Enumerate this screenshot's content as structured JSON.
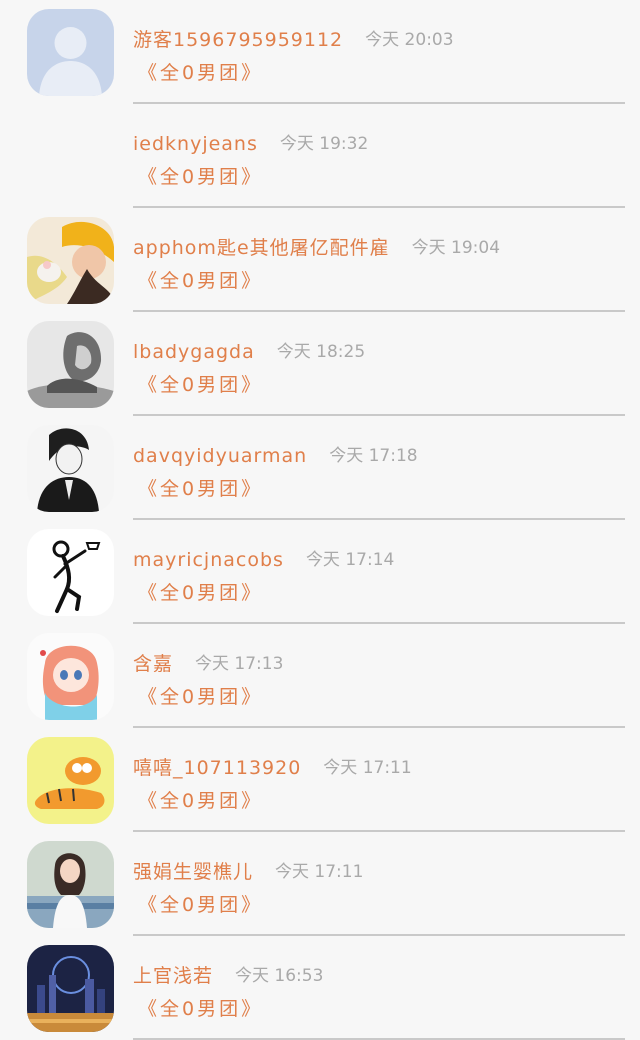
{
  "threads": [
    {
      "name": "游客1596795959112",
      "time": "今天 20:03",
      "subtitle": "《全0男团》",
      "avatar": "default-person-icon"
    },
    {
      "name": "iedknyjeans",
      "time": "今天 19:32",
      "subtitle": "《全0男团》",
      "avatar": ""
    },
    {
      "name": "apphom匙e其他屠亿配件雇",
      "time": "今天 19:04",
      "subtitle": "《全0男团》",
      "avatar": "girl-yellow-hat-photo"
    },
    {
      "name": "lbadygagda",
      "time": "今天 18:25",
      "subtitle": "《全0男团》",
      "avatar": "lion-sketch"
    },
    {
      "name": "davqyidyuarman",
      "time": "今天 17:18",
      "subtitle": "《全0男团》",
      "avatar": "anime-boy-sketch"
    },
    {
      "name": "mayricjnacobs",
      "time": "今天 17:14",
      "subtitle": "《全0男团》",
      "avatar": "stick-figure-basketball"
    },
    {
      "name": "含嘉",
      "time": "今天 17:13",
      "subtitle": "《全0男团》",
      "avatar": "anime-girl-pink-hair"
    },
    {
      "name": "嘻嘻_107113920",
      "time": "今天 17:11",
      "subtitle": "《全0男团》",
      "avatar": "garfield-cartoon"
    },
    {
      "name": "强娟生婴樵儿",
      "time": "今天 17:11",
      "subtitle": "《全0男团》",
      "avatar": "girl-bench-photo"
    },
    {
      "name": "上官浅若",
      "time": "今天 16:53",
      "subtitle": "《全0男团》",
      "avatar": "city-night-photo"
    }
  ]
}
